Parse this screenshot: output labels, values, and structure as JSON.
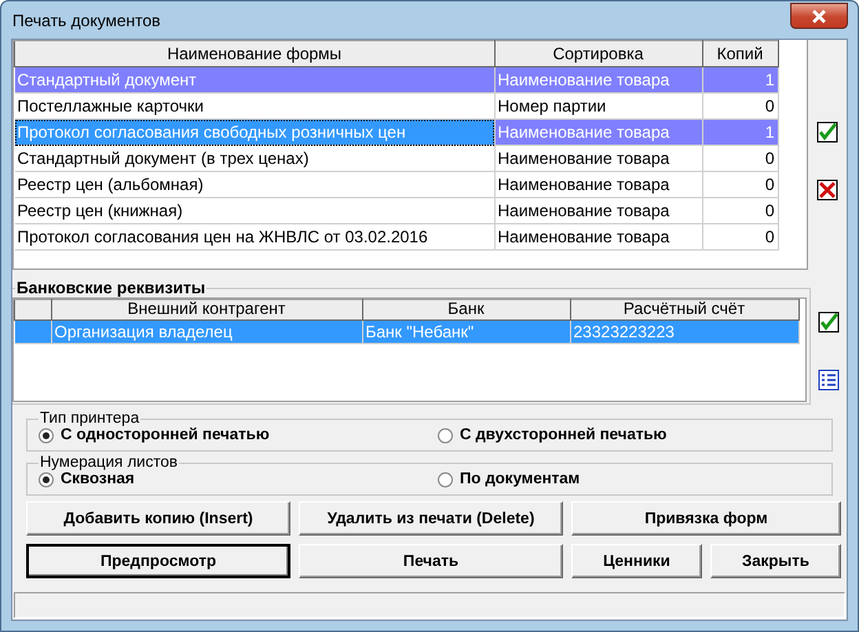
{
  "window": {
    "title": "Печать документов"
  },
  "forms_table": {
    "columns": [
      "Наименование формы",
      "Сортировка",
      "Копий"
    ],
    "rows": [
      {
        "cells": [
          "Стандартный документ",
          "Наименование товара",
          "1"
        ],
        "selected": true,
        "focused": false
      },
      {
        "cells": [
          "Постеллажные карточки",
          "Номер партии",
          "0"
        ],
        "selected": false,
        "focused": false
      },
      {
        "cells": [
          "Протокол согласования свободных розничных цен",
          "Наименование товара",
          "1"
        ],
        "selected": true,
        "focused": true
      },
      {
        "cells": [
          "Стандартный документ (в трех ценах)",
          "Наименование товара",
          "0"
        ],
        "selected": false,
        "focused": false
      },
      {
        "cells": [
          "Реестр цен (альбомная)",
          "Наименование товара",
          "0"
        ],
        "selected": false,
        "focused": false
      },
      {
        "cells": [
          "Реестр цен (книжная)",
          "Наименование товара",
          "0"
        ],
        "selected": false,
        "focused": false
      },
      {
        "cells": [
          "Протокол согласования цен на ЖНВЛС от 03.02.2016",
          "Наименование товара",
          "0"
        ],
        "selected": false,
        "focused": false
      }
    ]
  },
  "bank_details": {
    "title": "Банковские реквизиты",
    "columns": [
      "Внешний контрагент",
      "Банк",
      "Расчётный счёт"
    ],
    "rows": [
      {
        "cells": [
          "Организация владелец",
          "Банк \"Небанк\"",
          "23323223223"
        ],
        "selected": true
      }
    ]
  },
  "printer_type": {
    "title": "Тип принтера",
    "options": [
      {
        "label": "С односторонней печатью",
        "selected": true
      },
      {
        "label": "С двухсторонней печатью",
        "selected": false
      }
    ]
  },
  "page_numbering": {
    "title": "Нумерация листов",
    "options": [
      {
        "label": "Сквозная",
        "selected": true
      },
      {
        "label": "По документам",
        "selected": false
      }
    ]
  },
  "buttons": [
    {
      "label": "Добавить копию (Insert)",
      "default": false
    },
    {
      "label": "Удалить из печати (Delete)",
      "default": false
    },
    {
      "label": "Привязка форм",
      "default": false
    },
    {
      "label": "Предпросмотр",
      "default": true
    },
    {
      "label": "Печать",
      "default": false
    },
    {
      "label": "Ценники",
      "default": false
    },
    {
      "label": "Закрыть",
      "default": false
    }
  ]
}
